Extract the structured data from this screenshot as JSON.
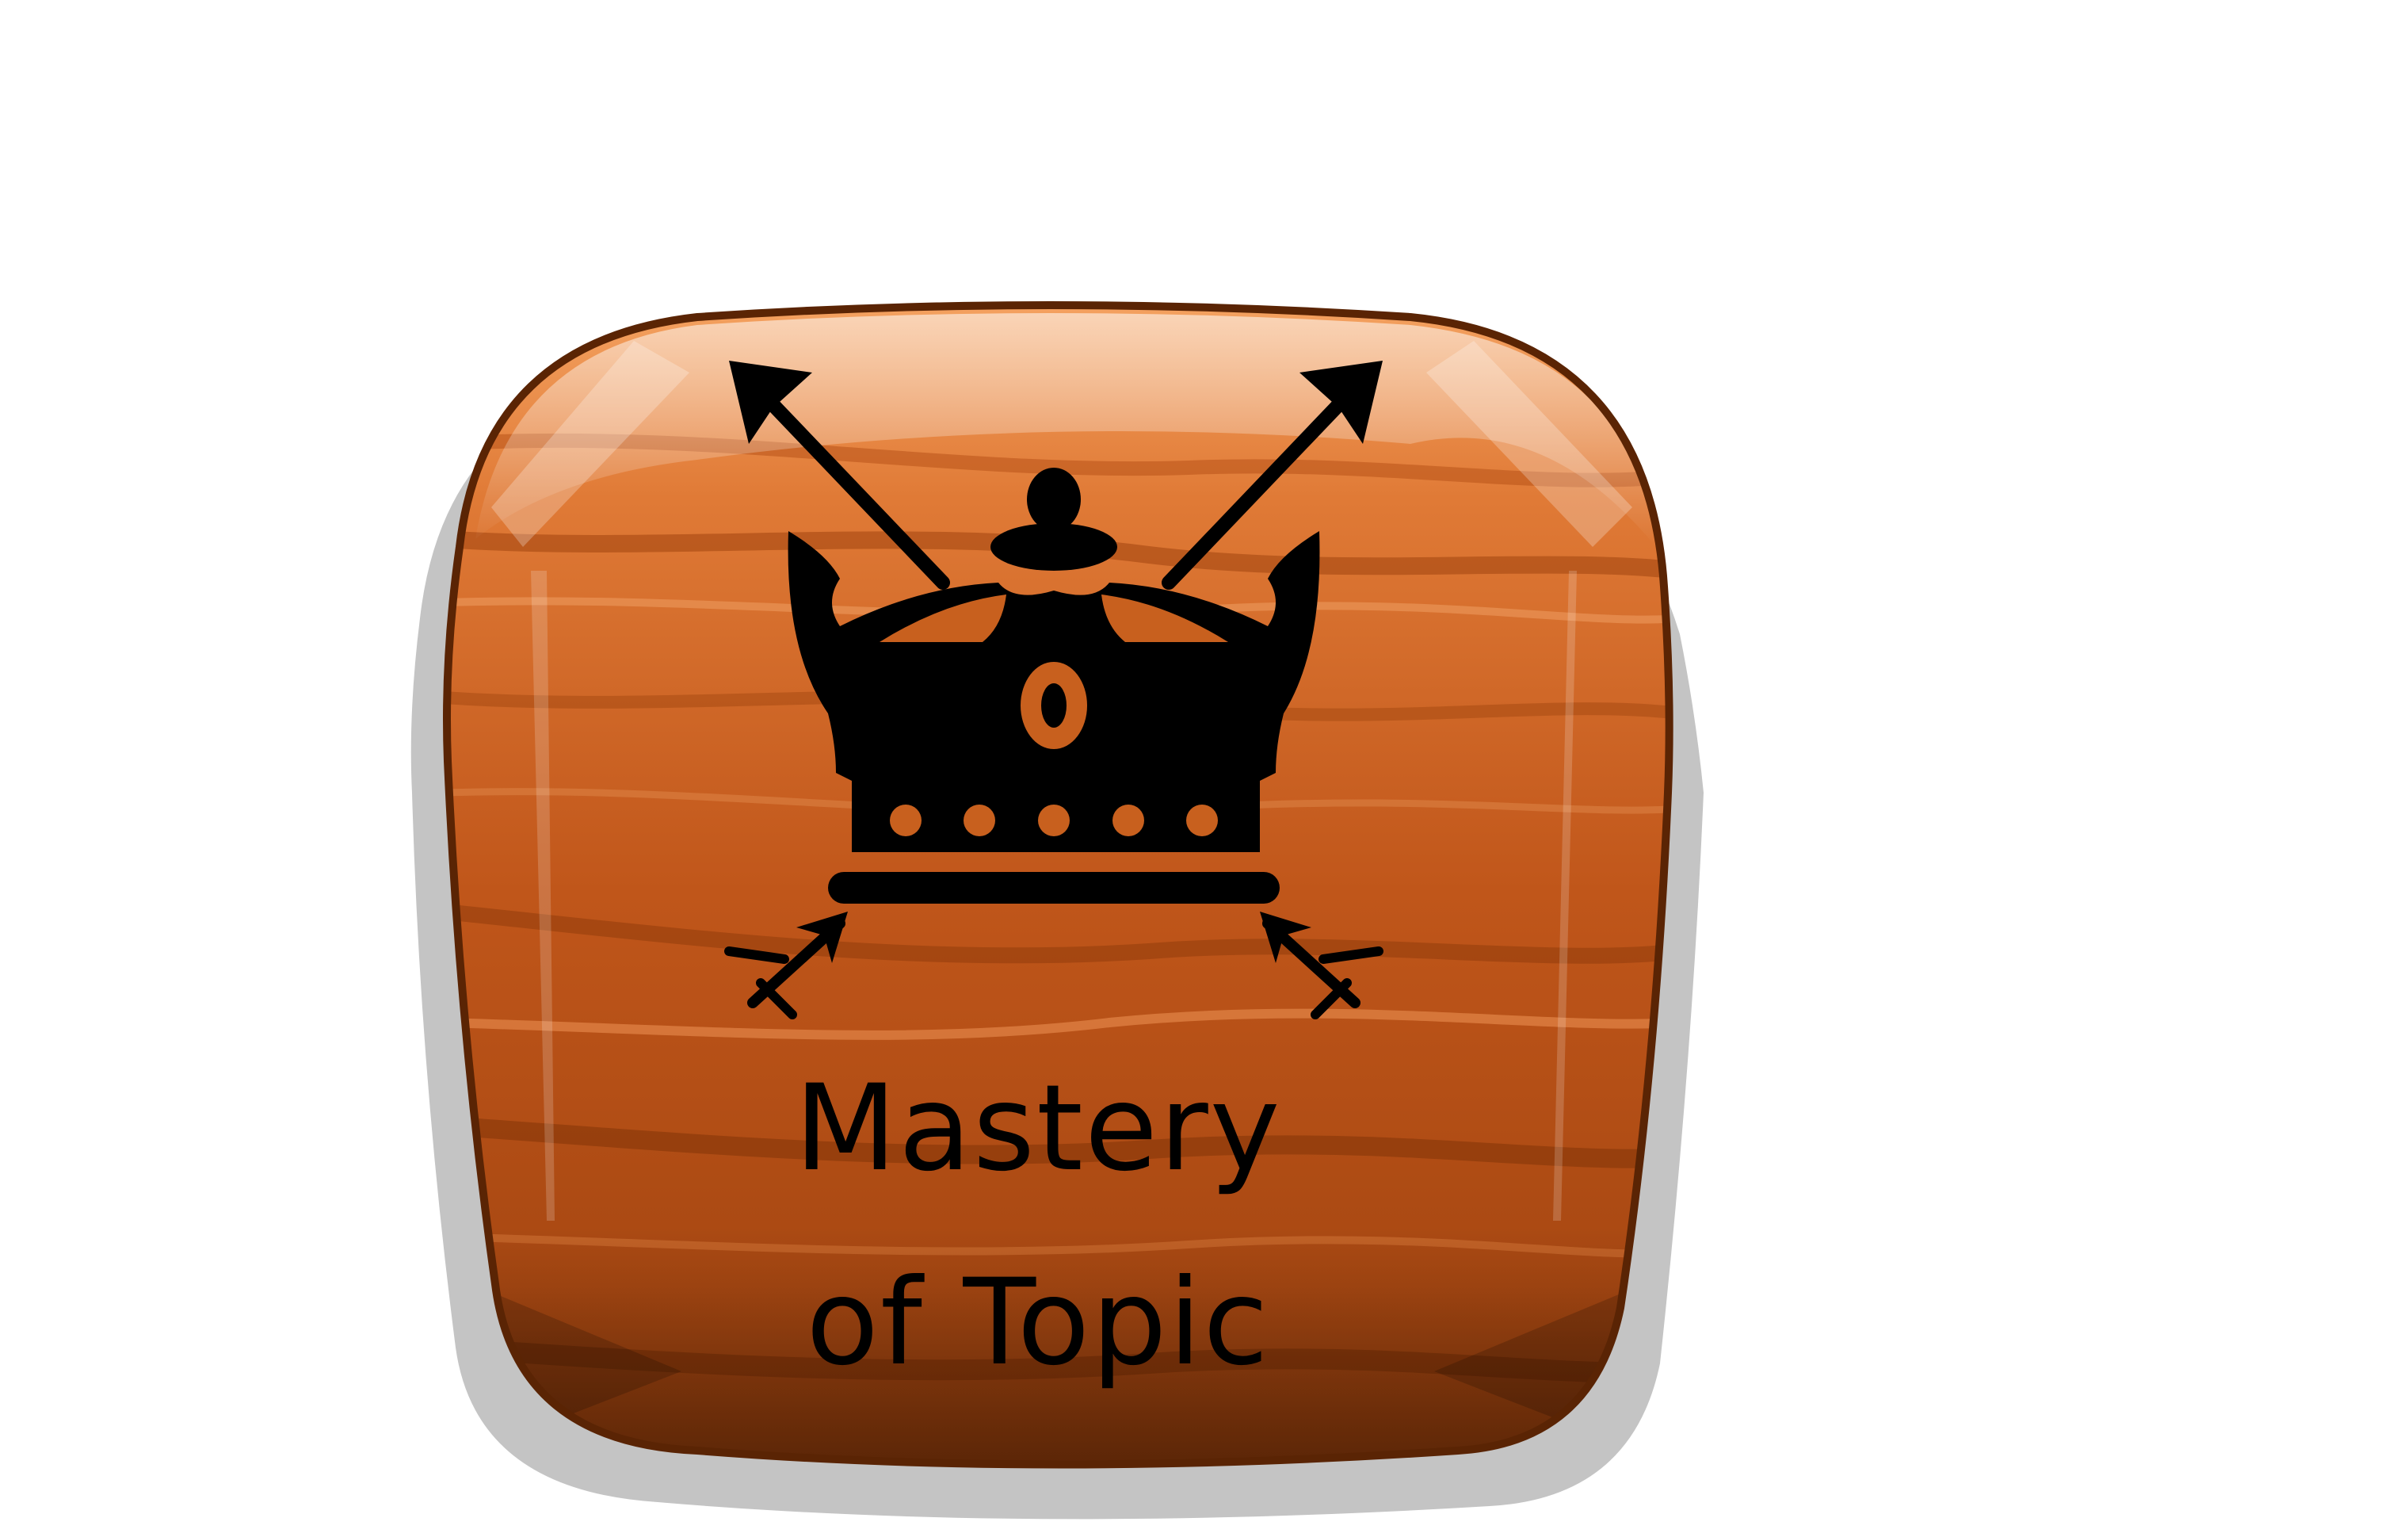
{
  "badge": {
    "title_line1": "Mastery",
    "title_line2": "of Topic",
    "icon": "crown-with-arrows-icon"
  },
  "colors": {
    "wood_light": "#F39A5A",
    "wood_mid": "#C8601E",
    "wood_dark": "#8A3A08",
    "border": "#5A2404",
    "shadow": "#C4C4C4",
    "ink": "#000000"
  }
}
